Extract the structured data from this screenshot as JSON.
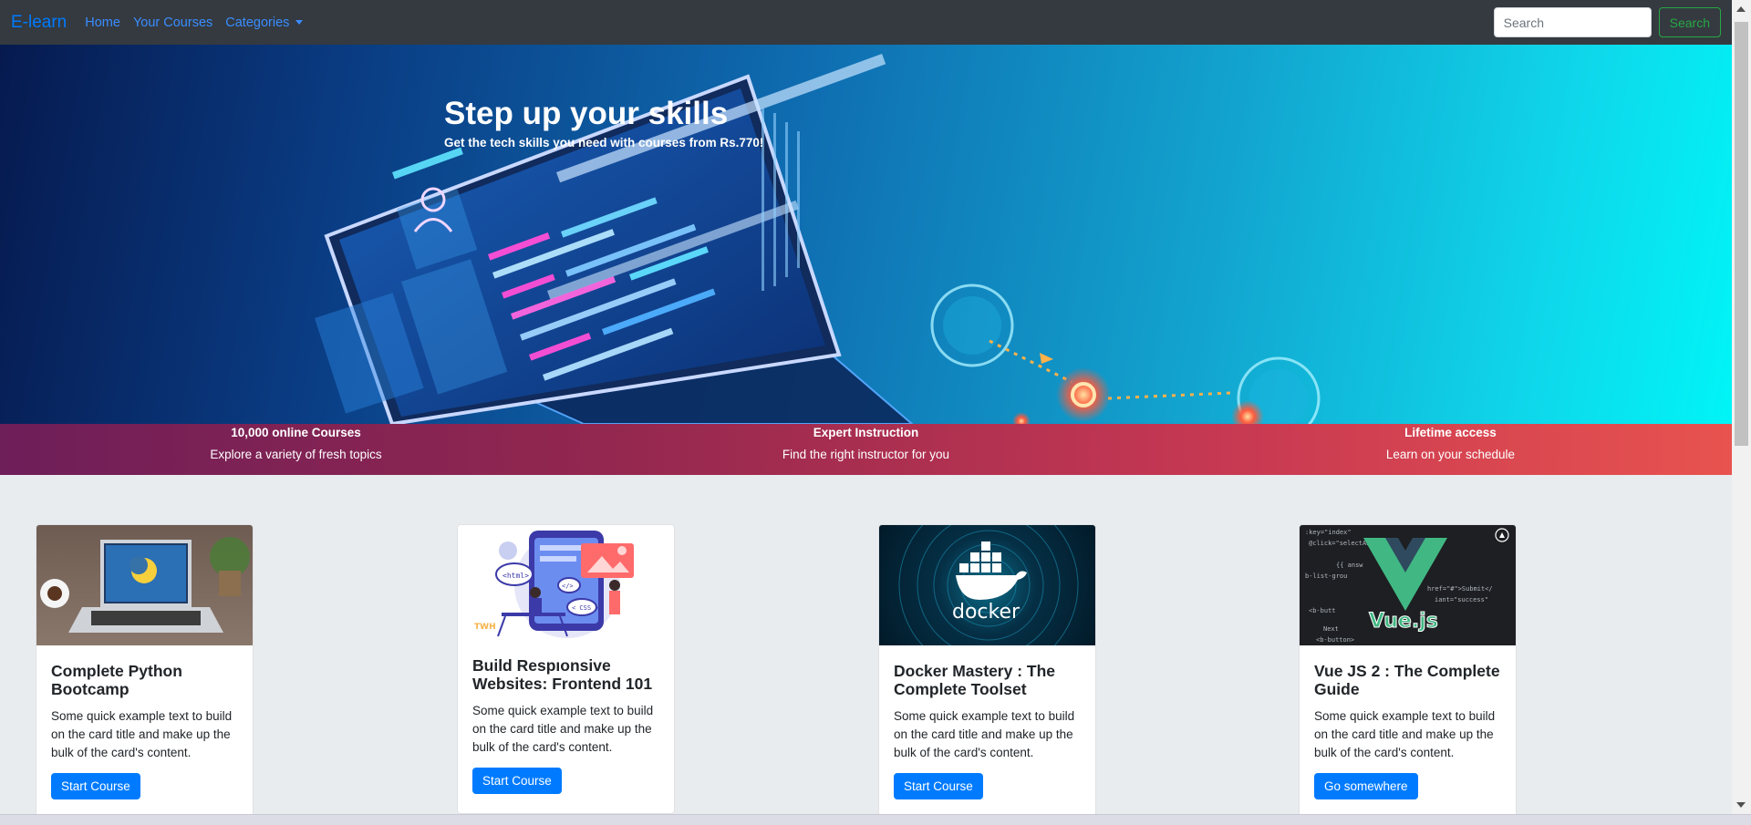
{
  "navbar": {
    "brand": "E-learn",
    "links": [
      {
        "label": "Home"
      },
      {
        "label": "Your Courses"
      },
      {
        "label": "Categories"
      }
    ],
    "search": {
      "placeholder": "Search",
      "value": ""
    },
    "search_button": "Search"
  },
  "hero": {
    "title": "Step up your skills",
    "subtitle": "Get the tech skills you need with courses from Rs.770!"
  },
  "features": [
    {
      "title": "10,000 online Courses",
      "text": "Explore a variety of fresh topics"
    },
    {
      "title": "Expert Instruction",
      "text": "Find the right instructor for you"
    },
    {
      "title": "Lifetime access",
      "text": "Learn on your schedule"
    }
  ],
  "cards": [
    {
      "title": "Complete Python Bootcamp",
      "text": "Some quick example text to build on the card title and make up the bulk of the card's content.",
      "button": "Start Course"
    },
    {
      "title": "Build Respıonsive Websites: Frontend 101",
      "text": "Some quick example text to build on the card title and make up the bulk of the card's content.",
      "button": "Start Course"
    },
    {
      "title": "Docker Mastery : The Complete Toolset",
      "text": "Some quick example text to build on the card title and make up the bulk of the card's content.",
      "button": "Start Course"
    },
    {
      "title": "Vue JS 2 : The Complete Guide",
      "text": "Some quick example text to build on the card title and make up the bulk of the card's content.",
      "button": "Go somewhere"
    }
  ],
  "card_images": {
    "python": {
      "logo_text": "",
      "colors": [
        "#7a6a60",
        "#d9d9df"
      ]
    },
    "frontend": {
      "tags": [
        "<html>",
        "</>",
        "< CSS >"
      ],
      "watermark": "TWH"
    },
    "docker": {
      "logo_text": "docker"
    },
    "vue": {
      "logo_text": "Vue.js",
      "code_lines": [
        ":key=\"index\"",
        "@click=\"selectAnswer\"",
        "{{ answ",
        "b-list-grou",
        "href=\"#\">Submit</",
        "iant=\"success\"",
        "<b-butt",
        "Next",
        "<b-button>"
      ]
    }
  },
  "colors": {
    "navbar_bg": "#343a40",
    "brand": "#007bff",
    "primary_button": "#007bff",
    "search_button": "#28a745"
  }
}
